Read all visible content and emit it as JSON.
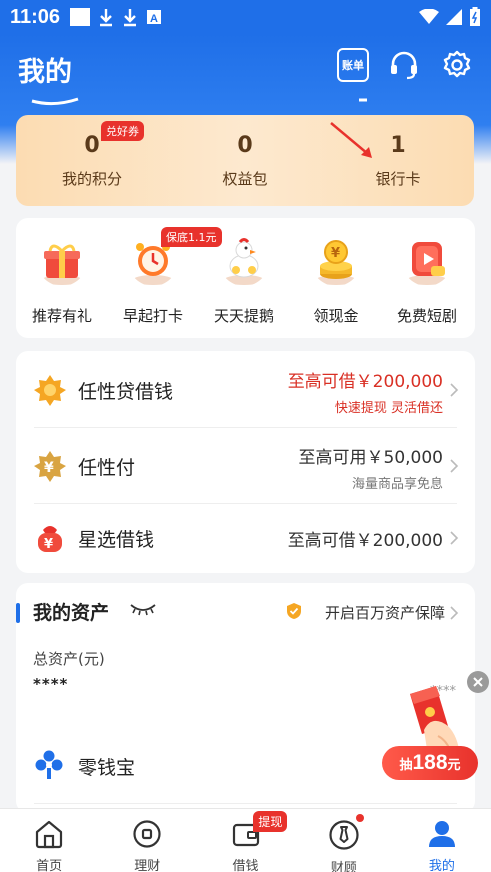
{
  "status_bar": {
    "time": "11:06"
  },
  "header": {
    "title": "我的",
    "bill_label": "账单"
  },
  "stats": {
    "badge": "兑好券",
    "items": [
      {
        "value": "0",
        "label": "我的积分"
      },
      {
        "value": "0",
        "label": "权益包"
      },
      {
        "value": "1",
        "label": "银行卡"
      }
    ]
  },
  "quick_actions": {
    "badge": "保底1.1元",
    "items": [
      {
        "label": "推荐有礼"
      },
      {
        "label": "早起打卡"
      },
      {
        "label": "天天提鹅"
      },
      {
        "label": "领现金"
      },
      {
        "label": "免费短剧"
      }
    ]
  },
  "loans": [
    {
      "name": "任性贷借钱",
      "main": "至高可借￥200,000",
      "sub": "快速提现 灵活借还"
    },
    {
      "name": "任性付",
      "main": "至高可用￥50,000",
      "sub": "海量商品享免息"
    },
    {
      "name": "星选借钱",
      "main": "至高可借￥200,000",
      "sub": ""
    }
  ],
  "assets": {
    "title": "我的资产",
    "protect": "开启百万资产保障",
    "total_label": "总资产(元)",
    "total_value": "****",
    "product": "零钱宝"
  },
  "promo": {
    "masked": "****",
    "label": "抽",
    "amount": "188",
    "unit": "元"
  },
  "tabs": {
    "badge": "提现",
    "items": [
      {
        "label": "首页"
      },
      {
        "label": "理财"
      },
      {
        "label": "借钱"
      },
      {
        "label": "财顾"
      },
      {
        "label": "我的"
      }
    ]
  },
  "colors": {
    "brand_blue": "#1f6fe8",
    "accent_red": "#e8322c",
    "text_red": "#d93025"
  }
}
